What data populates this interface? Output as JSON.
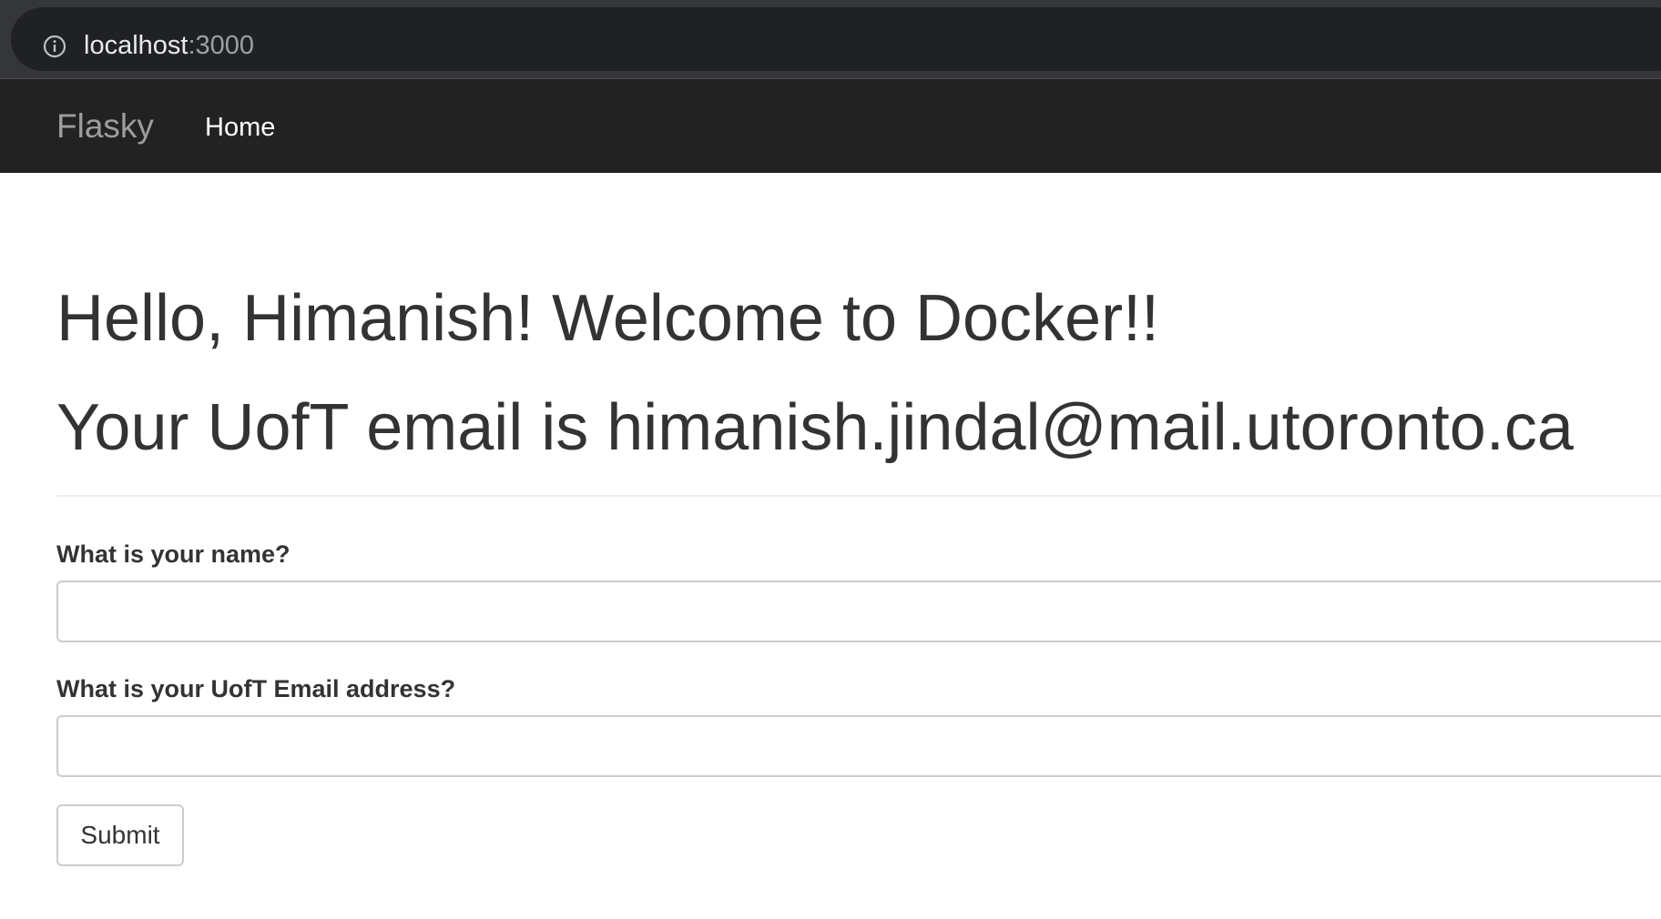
{
  "browser": {
    "url_host": "localhost",
    "url_port": ":3000",
    "info_icon": "info-circle-icon"
  },
  "navbar": {
    "brand": "Flasky",
    "home_label": "Home",
    "background": "#222222"
  },
  "main": {
    "greeting": "Hello, Himanish! Welcome to Docker!!",
    "email_line": "Your UofT email is himanish.jindal@mail.utoronto.ca"
  },
  "form": {
    "name_label": "What is your name?",
    "name_value": "",
    "email_label": "What is your UofT Email address?",
    "email_value": "",
    "submit_label": "Submit"
  }
}
